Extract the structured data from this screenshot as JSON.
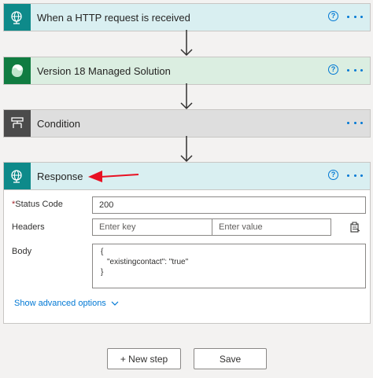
{
  "steps": [
    {
      "title": "When a HTTP request is received",
      "color": "#0e8a8a",
      "bg": "#d9eff1"
    },
    {
      "title": "Version 18 Managed Solution",
      "color": "#107c41",
      "bg": "#dbeee1"
    },
    {
      "title": "Condition",
      "color": "#4b4b4b",
      "bg": "#dedede"
    },
    {
      "title": "Response",
      "color": "#0e8a8a",
      "bg": "#d9eff1"
    }
  ],
  "help_glyph": "?",
  "response": {
    "status_code_label": "Status Code",
    "required_mark": "*",
    "status_code_value": "200",
    "headers_label": "Headers",
    "header_key_placeholder": "Enter key",
    "header_value_placeholder": "Enter value",
    "body_label": "Body",
    "body_lines": [
      "{",
      "\"existingcontact\": \"true\"",
      "}"
    ],
    "advanced_link": "Show advanced options"
  },
  "footer": {
    "new_step": "+ New step",
    "save": "Save"
  },
  "annotation_arrow_color": "#e81123"
}
